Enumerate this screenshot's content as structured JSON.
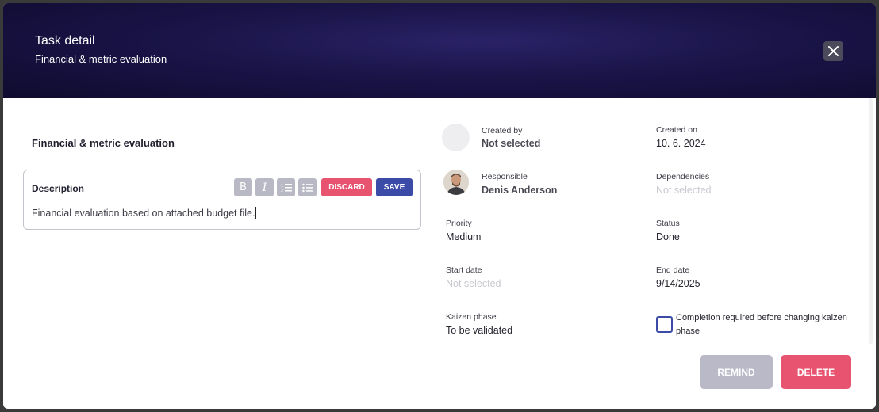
{
  "header": {
    "title": "Task detail",
    "subtitle": "Financial & metric evaluation",
    "close_icon": "close-icon"
  },
  "task": {
    "title": "Financial & metric evaluation"
  },
  "description": {
    "label": "Description",
    "text": "Financial evaluation based on attached budget file.",
    "toolbar": {
      "bold_icon": "bold-icon",
      "italic_icon": "italic-icon",
      "ordered_list_icon": "ordered-list-icon",
      "bullet_list_icon": "bullet-list-icon",
      "discard_label": "DISCARD",
      "save_label": "SAVE"
    }
  },
  "fields": {
    "created_by": {
      "label": "Created by",
      "value": "Not selected"
    },
    "created_on": {
      "label": "Created on",
      "value": "10. 6. 2024"
    },
    "responsible": {
      "label": "Responsible",
      "value": "Denis Anderson"
    },
    "dependencies": {
      "label": "Dependencies",
      "value": "Not selected"
    },
    "priority": {
      "label": "Priority",
      "value": "Medium"
    },
    "status": {
      "label": "Status",
      "value": "Done"
    },
    "start_date": {
      "label": "Start date",
      "value": "Not selected"
    },
    "end_date": {
      "label": "End date",
      "value": "9/14/2025"
    },
    "kaizen_phase": {
      "label": "Kaizen phase",
      "value": "To be validated"
    },
    "completion_required": {
      "label": "Completion required before changing kaizen phase",
      "checked": false
    }
  },
  "actions": {
    "remind_label": "REMIND",
    "delete_label": "DELETE"
  },
  "colors": {
    "accent": "#3c4aa8",
    "danger": "#e85470",
    "disabled": "#b9b9c8",
    "header_bg": "#1a1448"
  }
}
